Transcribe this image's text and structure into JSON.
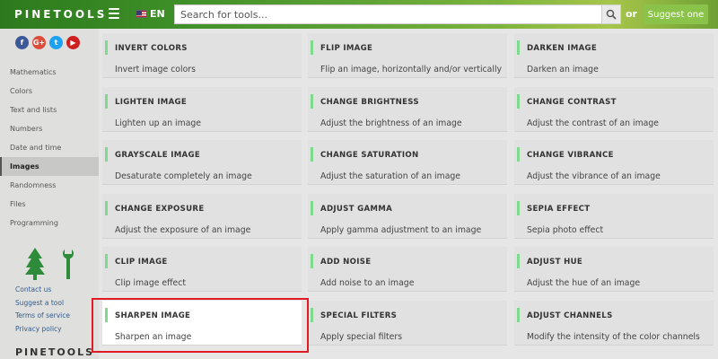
{
  "header": {
    "logo": "PINETOOLS",
    "language": "EN",
    "search_placeholder": "Search for tools...",
    "or_text": "or",
    "suggest_label": "Suggest one"
  },
  "sidebar": {
    "socials": [
      "f",
      "G+",
      "t",
      "▶"
    ],
    "items": [
      {
        "label": "Mathematics",
        "active": false
      },
      {
        "label": "Colors",
        "active": false
      },
      {
        "label": "Text and lists",
        "active": false
      },
      {
        "label": "Numbers",
        "active": false
      },
      {
        "label": "Date and time",
        "active": false
      },
      {
        "label": "Images",
        "active": true
      },
      {
        "label": "Randomness",
        "active": false
      },
      {
        "label": "Files",
        "active": false
      },
      {
        "label": "Programming",
        "active": false
      }
    ],
    "footer_links": [
      "Contact us",
      "Suggest a tool",
      "Terms of service",
      "Privacy policy"
    ],
    "logo": "PINETOOLS"
  },
  "tools": [
    [
      {
        "title": "INVERT COLORS",
        "desc": "Invert image colors"
      },
      {
        "title": "FLIP IMAGE",
        "desc": "Flip an image, horizontally and/or vertically"
      },
      {
        "title": "DARKEN IMAGE",
        "desc": "Darken an image"
      }
    ],
    [
      {
        "title": "LIGHTEN IMAGE",
        "desc": "Lighten up an image"
      },
      {
        "title": "CHANGE BRIGHTNESS",
        "desc": "Adjust the brightness of an image"
      },
      {
        "title": "CHANGE CONTRAST",
        "desc": "Adjust the contrast of an image"
      }
    ],
    [
      {
        "title": "GRAYSCALE IMAGE",
        "desc": "Desaturate completely an image"
      },
      {
        "title": "CHANGE SATURATION",
        "desc": "Adjust the saturation of an image"
      },
      {
        "title": "CHANGE VIBRANCE",
        "desc": "Adjust the vibrance of an image"
      }
    ],
    [
      {
        "title": "CHANGE EXPOSURE",
        "desc": "Adjust the exposure of an image"
      },
      {
        "title": "ADJUST GAMMA",
        "desc": "Apply gamma adjustment to an image"
      },
      {
        "title": "SEPIA EFFECT",
        "desc": "Sepia photo effect"
      }
    ],
    [
      {
        "title": "CLIP IMAGE",
        "desc": "Clip image effect"
      },
      {
        "title": "ADD NOISE",
        "desc": "Add noise to an image"
      },
      {
        "title": "ADJUST HUE",
        "desc": "Adjust the hue of an image"
      }
    ],
    [
      {
        "title": "SHARPEN IMAGE",
        "desc": "Sharpen an image",
        "highlighted": true
      },
      {
        "title": "SPECIAL FILTERS",
        "desc": "Apply special filters"
      },
      {
        "title": "ADJUST CHANNELS",
        "desc": "Modify the intensity of the color channels"
      }
    ]
  ]
}
